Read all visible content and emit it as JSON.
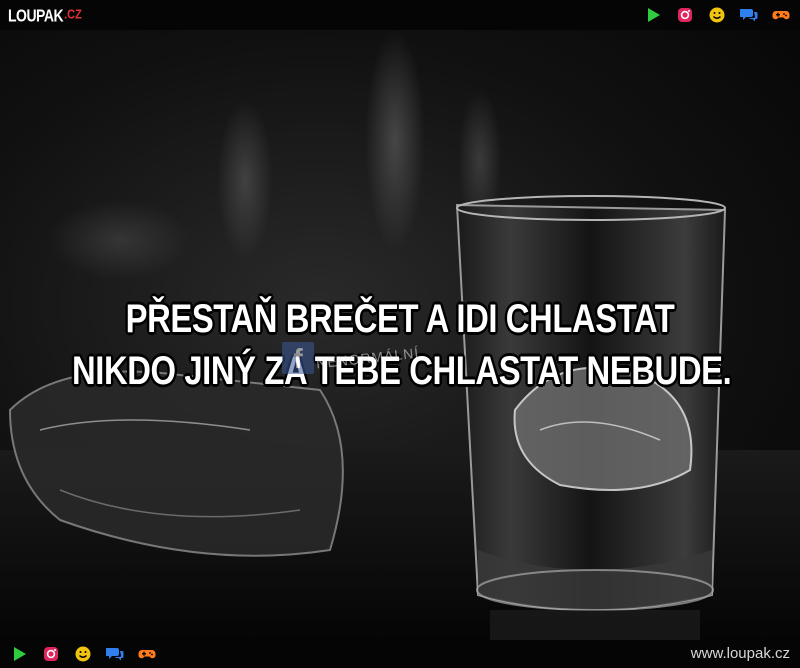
{
  "header": {
    "logo_word": "LOUPAK",
    "logo_tld": ".CZ",
    "icons": [
      "play-icon",
      "instagram-icon",
      "smiley-icon",
      "chat-icon",
      "gamepad-icon"
    ]
  },
  "caption": {
    "line1": "PŘESTAŇ BREČET A IDI CHLASTAT",
    "line2": "NIKDO JINÝ ZA TEBE CHLASTAT NEBUDE."
  },
  "watermark": {
    "fb_letter": "f",
    "text": "NENORMÁLNÍ"
  },
  "footer": {
    "icons": [
      "play-icon",
      "instagram-icon",
      "smiley-icon",
      "chat-icon",
      "gamepad-icon"
    ],
    "site_url": "www.loupak.cz"
  },
  "colors": {
    "play": "#2ecc40",
    "instagram": "#e0245e",
    "smiley": "#f1c40f",
    "chat": "#2f80ed",
    "gamepad": "#ff7a1a",
    "logo_tld": "#e33434"
  }
}
